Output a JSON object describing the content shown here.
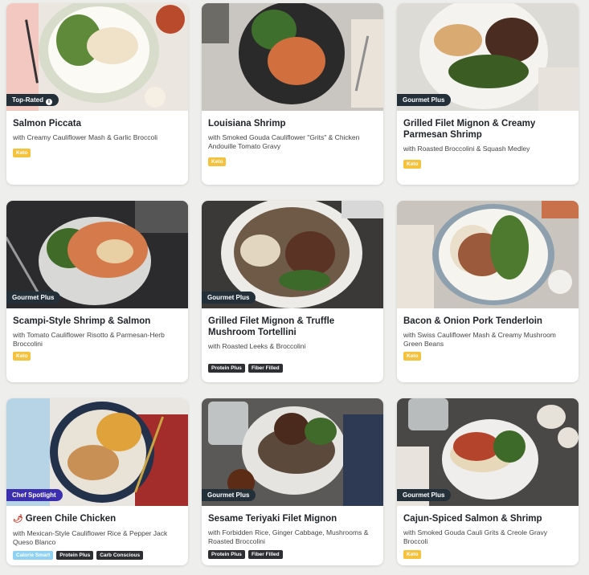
{
  "meals": [
    {
      "title": "Salmon Piccata",
      "subtitle": "with Creamy Cauliflower Mash & Garlic Broccoli",
      "badge": "Top-Rated",
      "badge_info_icon": "info-icon",
      "tags": [
        {
          "label": "Keto",
          "style": "keto"
        }
      ]
    },
    {
      "title": "Louisiana Shrimp",
      "subtitle": "with Smoked Gouda Cauliflower \"Grits\" & Chicken Andouille Tomato Gravy",
      "badge": "",
      "tags": [
        {
          "label": "Keto",
          "style": "keto"
        }
      ]
    },
    {
      "title": "Grilled Filet Mignon & Creamy Parmesan Shrimp",
      "subtitle": "with Roasted Broccolini & Squash Medley",
      "badge": "Gourmet Plus",
      "tags": [
        {
          "label": "Keto",
          "style": "keto"
        }
      ]
    },
    {
      "title": "Scampi-Style Shrimp & Salmon",
      "subtitle": "with Tomato Cauliflower Risotto & Parmesan-Herb Broccolini",
      "badge": "Gourmet Plus",
      "tags": [
        {
          "label": "Keto",
          "style": "keto"
        }
      ]
    },
    {
      "title": "Grilled Filet Mignon & Truffle Mushroom Tortellini",
      "subtitle": "with Roasted Leeks & Broccolini",
      "badge": "Gourmet Plus",
      "tags": [
        {
          "label": "Protein Plus",
          "style": "dark"
        },
        {
          "label": "Fiber Filled",
          "style": "dark"
        }
      ]
    },
    {
      "title": "Bacon & Onion Pork Tenderloin",
      "subtitle": "with Swiss Cauliflower Mash & Creamy Mushroom Green Beans",
      "badge": "",
      "tags": [
        {
          "label": "Keto",
          "style": "keto"
        }
      ]
    },
    {
      "title": "Green Chile Chicken",
      "title_icon": "chili-pepper-icon",
      "subtitle": "with Mexican-Style Cauliflower Rice & Pepper Jack Queso Blanco",
      "badge": "Chef Spotlight",
      "tags": [
        {
          "label": "Calorie Smart",
          "style": "smart"
        },
        {
          "label": "Protein Plus",
          "style": "dark"
        },
        {
          "label": "Carb Conscious",
          "style": "dark"
        }
      ]
    },
    {
      "title": "Sesame Teriyaki Filet Mignon",
      "subtitle": "with Forbidden Rice, Ginger Cabbage, Mushrooms & Roasted Broccolini",
      "badge": "Gourmet Plus",
      "tags": [
        {
          "label": "Protein Plus",
          "style": "dark"
        },
        {
          "label": "Fiber Filled",
          "style": "dark"
        }
      ]
    },
    {
      "title": "Cajun-Spiced Salmon & Shrimp",
      "subtitle": "with Smoked Gouda Cauli Grits & Creole Gravy Broccoli",
      "badge": "Gourmet Plus",
      "tags": [
        {
          "label": "Keto",
          "style": "keto"
        }
      ]
    }
  ],
  "colors": {
    "keto": "#f4c23c",
    "dark_tag": "#2d2f33",
    "calorie_smart": "#8fd1f2",
    "badge": "#23303a",
    "chef_spotlight": "#3b2fb0"
  }
}
